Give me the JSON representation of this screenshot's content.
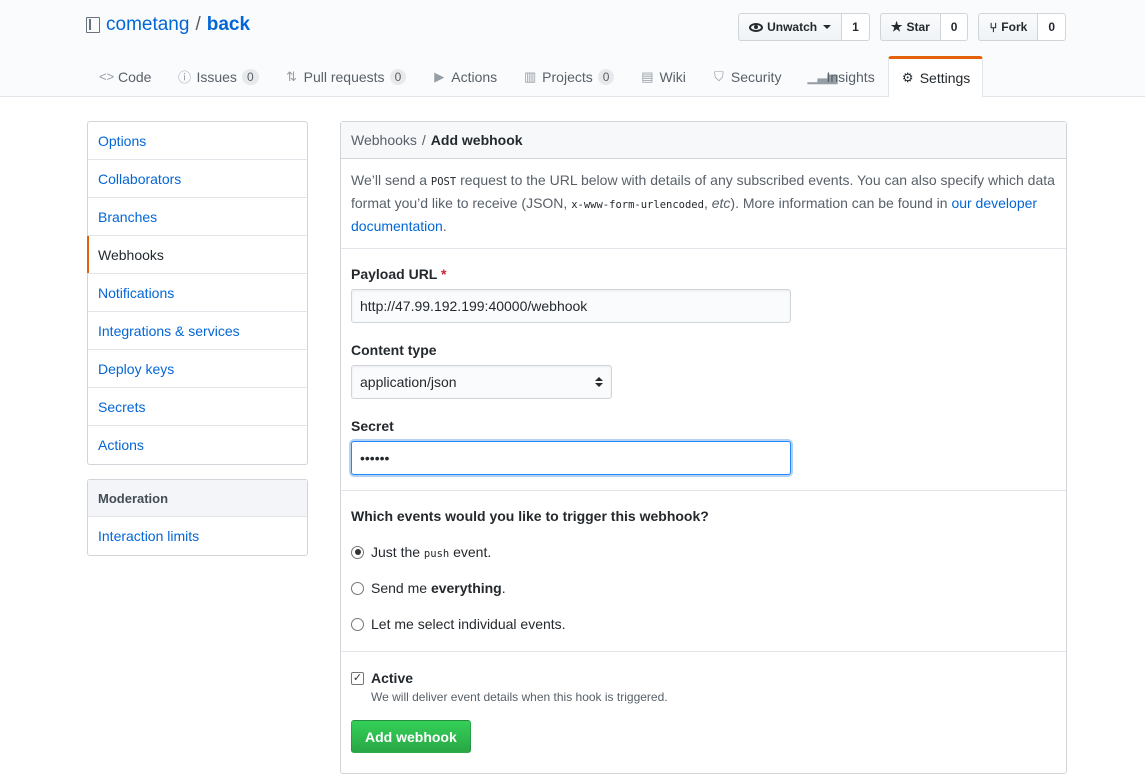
{
  "repo": {
    "owner": "cometang",
    "separator": "/",
    "name": "back"
  },
  "actions": {
    "watch": {
      "label": "Unwatch",
      "count": "1"
    },
    "star": {
      "label": "Star",
      "count": "0"
    },
    "fork": {
      "label": "Fork",
      "count": "0"
    }
  },
  "tabs": [
    {
      "label": "Code",
      "icon": "code-icon"
    },
    {
      "label": "Issues",
      "icon": "issue-icon",
      "counter": "0"
    },
    {
      "label": "Pull requests",
      "icon": "pull-request-icon",
      "counter": "0"
    },
    {
      "label": "Actions",
      "icon": "play-icon"
    },
    {
      "label": "Projects",
      "icon": "project-icon",
      "counter": "0"
    },
    {
      "label": "Wiki",
      "icon": "book-icon"
    },
    {
      "label": "Security",
      "icon": "shield-icon"
    },
    {
      "label": "Insights",
      "icon": "graph-icon"
    },
    {
      "label": "Settings",
      "icon": "gear-icon",
      "selected": true
    }
  ],
  "sidebar": {
    "items": [
      "Options",
      "Collaborators",
      "Branches",
      "Webhooks",
      "Notifications",
      "Integrations & services",
      "Deploy keys",
      "Secrets",
      "Actions"
    ],
    "selected": "Webhooks",
    "moderation": {
      "heading": "Moderation",
      "items": [
        "Interaction limits"
      ]
    }
  },
  "form": {
    "breadcrumb": {
      "parent": "Webhooks",
      "separator": "/",
      "current": "Add webhook"
    },
    "intro": {
      "p1": "We’ll send a ",
      "code1": "POST",
      "p2": " request to the URL below with details of any subscribed events. You can also specify which data format you’d like to receive (JSON, ",
      "code2": "x-www-form-urlencoded",
      "p3": ", ",
      "etc": "etc",
      "p4": "). More information can be found in ",
      "link": "our developer documentation",
      "p5": "."
    },
    "payload_url": {
      "label": "Payload URL",
      "required_mark": "*",
      "value": "http://47.99.192.199:40000/webhook"
    },
    "content_type": {
      "label": "Content type",
      "value": "application/json"
    },
    "secret": {
      "label": "Secret",
      "value": "••••••"
    },
    "events": {
      "question": "Which events would you like to trigger this webhook?",
      "opt1_a": "Just the ",
      "opt1_code": "push",
      "opt1_b": " event.",
      "opt2_a": "Send me ",
      "opt2_b": "everything",
      "opt2_c": ".",
      "opt3": "Let me select individual events.",
      "selected": 1
    },
    "active": {
      "label": "Active",
      "checked": true,
      "note": "We will deliver event details when this hook is triggered."
    },
    "submit": "Add webhook"
  }
}
